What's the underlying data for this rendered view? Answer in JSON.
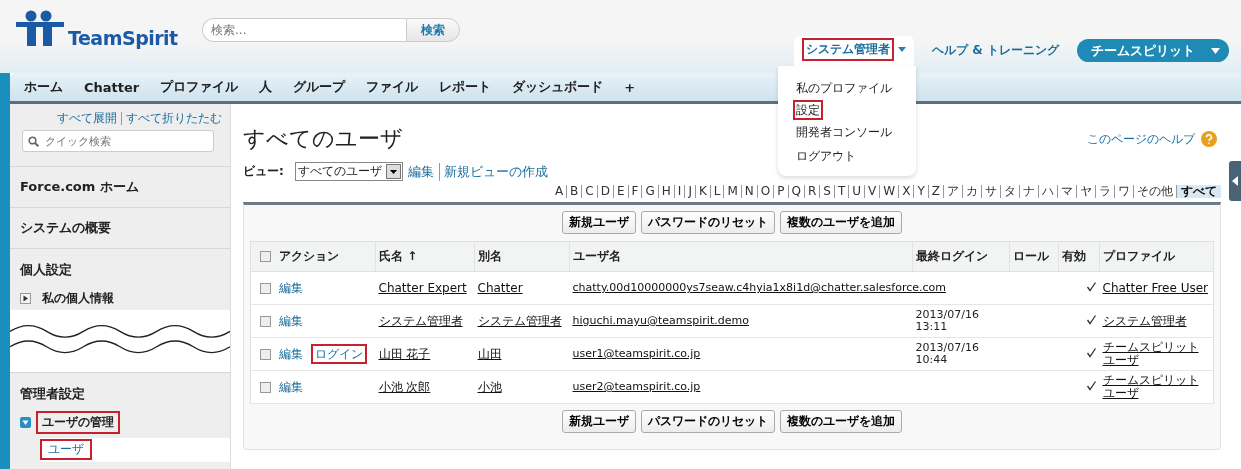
{
  "header": {
    "logo": "TeamSpirit",
    "search": {
      "placeholder": "検索...",
      "button": "検索"
    },
    "user_menu": {
      "label": "システム管理者",
      "highlighted": true,
      "expanded": true,
      "items": [
        {
          "label": "私のプロファイル",
          "highlighted": false
        },
        {
          "label": "設定",
          "highlighted": true
        },
        {
          "label": "開発者コンソール",
          "highlighted": false
        },
        {
          "label": "ログアウト",
          "highlighted": false
        }
      ]
    },
    "help_link": "ヘルプ & トレーニング",
    "app_menu": "チームスピリット"
  },
  "tabs": [
    {
      "label": "ホーム"
    },
    {
      "label": "Chatter"
    },
    {
      "label": "プロファイル"
    },
    {
      "label": "人"
    },
    {
      "label": "グループ"
    },
    {
      "label": "ファイル"
    },
    {
      "label": "レポート"
    },
    {
      "label": "ダッシュボード"
    },
    {
      "label": "+"
    }
  ],
  "sidebar": {
    "links": [
      "すべて展開",
      "すべて折りたたむ"
    ],
    "search": {
      "placeholder": "クイック検索"
    },
    "sections": [
      {
        "kind": "heading",
        "title": "Force.com ホーム"
      },
      {
        "kind": "heading",
        "title": "システムの概要"
      },
      {
        "kind": "group",
        "title": "個人設定",
        "items": [
          {
            "label": "私の個人情報",
            "expanded": false,
            "highlighted": false
          }
        ]
      },
      {
        "kind": "break"
      },
      {
        "kind": "group",
        "title": "管理者設定",
        "items": [
          {
            "label": "ユーザの管理",
            "expanded": true,
            "highlighted": true,
            "children": [
              {
                "label": "ユーザ",
                "highlighted": true
              }
            ]
          }
        ]
      }
    ]
  },
  "main": {
    "title": "すべてのユーザ",
    "help_link": "このページのヘルプ",
    "view": {
      "label": "ビュー:",
      "value": "すべてのユーザ",
      "links": [
        "編集",
        "新規ビューの作成"
      ]
    },
    "letters": [
      {
        "label": "A",
        "selected": false
      },
      {
        "label": "B",
        "selected": false
      },
      {
        "label": "C",
        "selected": false
      },
      {
        "label": "D",
        "selected": false
      },
      {
        "label": "E",
        "selected": false
      },
      {
        "label": "F",
        "selected": false
      },
      {
        "label": "G",
        "selected": false
      },
      {
        "label": "H",
        "selected": false
      },
      {
        "label": "I",
        "selected": false
      },
      {
        "label": "J",
        "selected": false
      },
      {
        "label": "K",
        "selected": false
      },
      {
        "label": "L",
        "selected": false
      },
      {
        "label": "M",
        "selected": false
      },
      {
        "label": "N",
        "selected": false
      },
      {
        "label": "O",
        "selected": false
      },
      {
        "label": "P",
        "selected": false
      },
      {
        "label": "Q",
        "selected": false
      },
      {
        "label": "R",
        "selected": false
      },
      {
        "label": "S",
        "selected": false
      },
      {
        "label": "T",
        "selected": false
      },
      {
        "label": "U",
        "selected": false
      },
      {
        "label": "V",
        "selected": false
      },
      {
        "label": "W",
        "selected": false
      },
      {
        "label": "X",
        "selected": false
      },
      {
        "label": "Y",
        "selected": false
      },
      {
        "label": "Z",
        "selected": false
      },
      {
        "label": "ア",
        "selected": false
      },
      {
        "label": "カ",
        "selected": false
      },
      {
        "label": "サ",
        "selected": false
      },
      {
        "label": "タ",
        "selected": false
      },
      {
        "label": "ナ",
        "selected": false
      },
      {
        "label": "ハ",
        "selected": false
      },
      {
        "label": "マ",
        "selected": false
      },
      {
        "label": "ヤ",
        "selected": false
      },
      {
        "label": "ラ",
        "selected": false
      },
      {
        "label": "ワ",
        "selected": false
      },
      {
        "label": "その他",
        "selected": false
      },
      {
        "label": "すべて",
        "selected": true
      }
    ],
    "buttons": [
      "新規ユーザ",
      "パスワードのリセット",
      "複数のユーザを追加"
    ],
    "table": {
      "all_checked": false,
      "columns": [
        "アクション",
        "氏名 ↑",
        "別名",
        "ユーザ名",
        "最終ログイン",
        "ロール",
        "有効",
        "プロファイル"
      ],
      "rows": [
        {
          "checked": false,
          "actions": [
            {
              "label": "編集",
              "highlighted": false
            }
          ],
          "name": "Chatter Expert",
          "alias": "Chatter",
          "username": "chatty.00d10000000ys7seaw.c4hyia1x8i1d@chatter.salesforce.com",
          "active": true,
          "profile": "Chatter Free User"
        },
        {
          "checked": false,
          "actions": [
            {
              "label": "編集",
              "highlighted": false
            }
          ],
          "name": "システム管理者",
          "alias": "システム管理者",
          "username": "higuchi.mayu@teamspirit.demo",
          "last_login": "2013/07/16 13:11",
          "active": true,
          "profile": "システム管理者"
        },
        {
          "checked": false,
          "actions": [
            {
              "label": "編集",
              "highlighted": false
            },
            {
              "label": "ログイン",
              "highlighted": true
            }
          ],
          "name": "山田 花子",
          "alias": "山田",
          "username": "user1@teamspirit.co.jp",
          "last_login": "2013/07/16 10:44",
          "active": true,
          "profile": "チームスピリットユーザ"
        },
        {
          "checked": false,
          "actions": [
            {
              "label": "編集",
              "highlighted": false
            }
          ],
          "name": "小池 次郎",
          "alias": "小池",
          "username": "user2@teamspirit.co.jp",
          "active": true,
          "profile": "チームスピリットユーザ"
        }
      ]
    },
    "bottom_buttons": [
      "新規ユーザ",
      "パスワードのリセット",
      "複数のユーザを追加"
    ]
  }
}
